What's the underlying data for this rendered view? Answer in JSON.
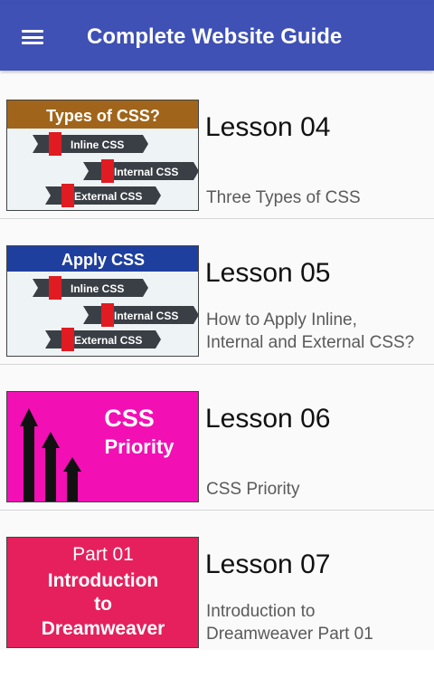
{
  "app": {
    "title": "Complete Website Guide",
    "menu_icon": "hamburger-menu-icon",
    "accent": "#3f51b5"
  },
  "lessons": [
    {
      "title": "Lesson 04",
      "description": [
        "Three Types of CSS"
      ],
      "thumbnail": {
        "heading": "Types of CSS?",
        "tags": [
          "Inline CSS",
          "Internal CSS",
          "External CSS"
        ],
        "header_color": "#a0651a"
      }
    },
    {
      "title": "Lesson 05",
      "description": [
        "How to Apply Inline,",
        "Internal and External CSS?"
      ],
      "thumbnail": {
        "heading": "Apply CSS",
        "tags": [
          "Inline CSS",
          "Internal CSS",
          "External CSS"
        ],
        "header_color": "#1f3f9e"
      }
    },
    {
      "title": "Lesson 06",
      "description": [
        "CSS Priority"
      ],
      "thumbnail": {
        "heading": "CSS",
        "subheading": "Priority",
        "background": "#f20fb4"
      }
    },
    {
      "title": "Lesson 07",
      "description": [
        "Introduction to",
        "Dreamweaver Part 01"
      ],
      "thumbnail": {
        "lines": [
          "Part 01",
          "Introduction",
          "to",
          "Dreamweaver"
        ],
        "background": "#e5205c"
      }
    }
  ]
}
